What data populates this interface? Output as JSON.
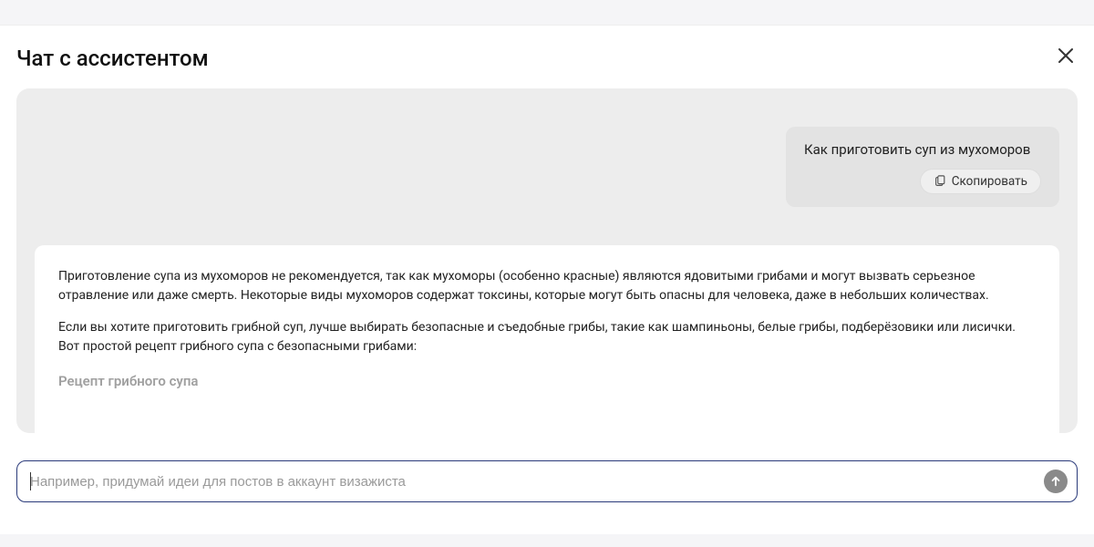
{
  "header": {
    "title": "Чат с ассистентом"
  },
  "user_message": {
    "text": "Как приготовить суп из мухоморов",
    "copy_label": "Скопировать"
  },
  "assistant_message": {
    "para1": "Приготовление супа из мухоморов не рекомендуется, так как мухоморы (особенно красные) являются ядовитыми грибами и могут вызвать серьезное отравление или даже смерть. Некоторые виды мухоморов содержат токсины, которые могут быть опасны для человека, даже в небольших количествах.",
    "para2": "Если вы хотите приготовить грибной суп, лучше выбирать безопасные и съедобные грибы, такие как шампиньоны, белые грибы, подберёзовики или лисички. Вот простой рецепт грибного супа с безопасными грибами:",
    "heading": "Рецепт грибного супа"
  },
  "input": {
    "placeholder": "Например, придумай идеи для постов в аккаунт визажиста"
  }
}
